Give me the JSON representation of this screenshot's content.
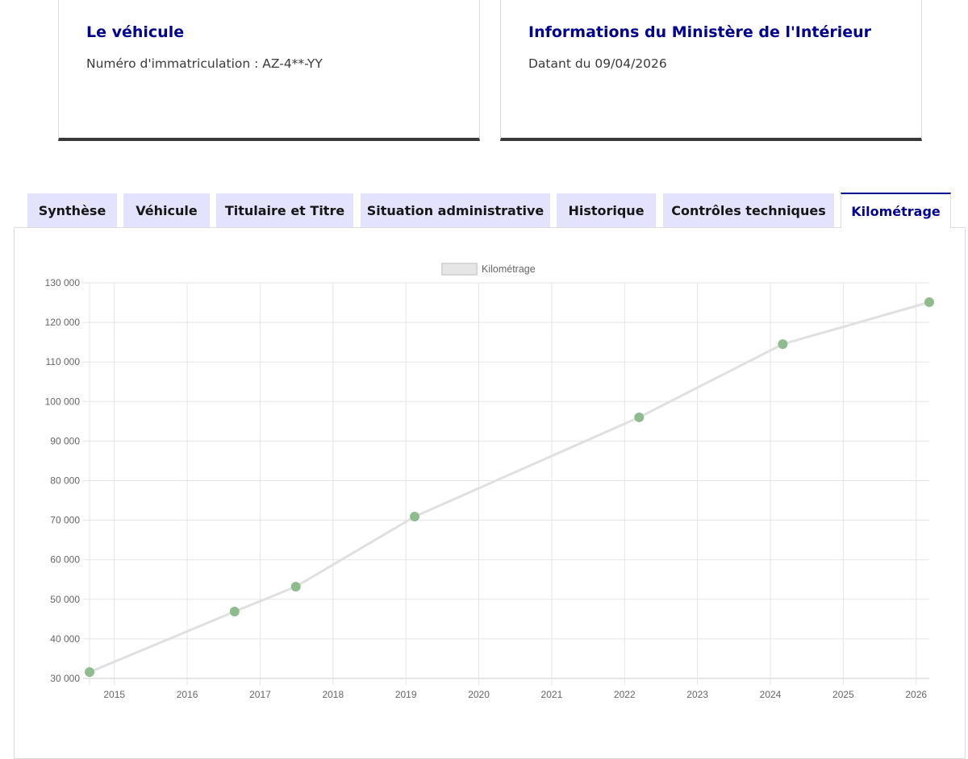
{
  "vehicle_card": {
    "title": "Le véhicule",
    "text": "Numéro d'immatriculation : AZ-4**-YY"
  },
  "ministry_card": {
    "title": "Informations du Ministère de l'Intérieur",
    "text": "Datant du 09/04/2026"
  },
  "tabs": [
    {
      "label": "Synthèse"
    },
    {
      "label": "Véhicule"
    },
    {
      "label": "Titulaire et Titre"
    },
    {
      "label": "Situation administrative"
    },
    {
      "label": "Historique"
    },
    {
      "label": "Contrôles techniques"
    },
    {
      "label": "Kilométrage",
      "active": true
    }
  ],
  "colors": {
    "accent": "#000091",
    "tab_bg": "#e3e3fd",
    "point": "#8fbc8f",
    "line": "#e0e0e0"
  },
  "chart_data": {
    "type": "line",
    "legend": {
      "label": "Kilométrage",
      "placement": "top-center"
    },
    "x": [
      2014.66,
      2016.65,
      2017.49,
      2019.12,
      2022.2,
      2024.17,
      2026.18
    ],
    "values": [
      31600,
      46900,
      53200,
      70900,
      96000,
      114500,
      125100
    ],
    "xlim": [
      2014.66,
      2026.18
    ],
    "ylim": [
      30000,
      130000
    ],
    "xticks": [
      "2015",
      "2016",
      "2017",
      "2018",
      "2019",
      "2020",
      "2021",
      "2022",
      "2023",
      "2024",
      "2025",
      "2026"
    ],
    "yticks": [
      "30 000",
      "40 000",
      "50 000",
      "60 000",
      "70 000",
      "80 000",
      "90 000",
      "100 000",
      "110 000",
      "120 000",
      "130 000"
    ],
    "grid": true
  }
}
